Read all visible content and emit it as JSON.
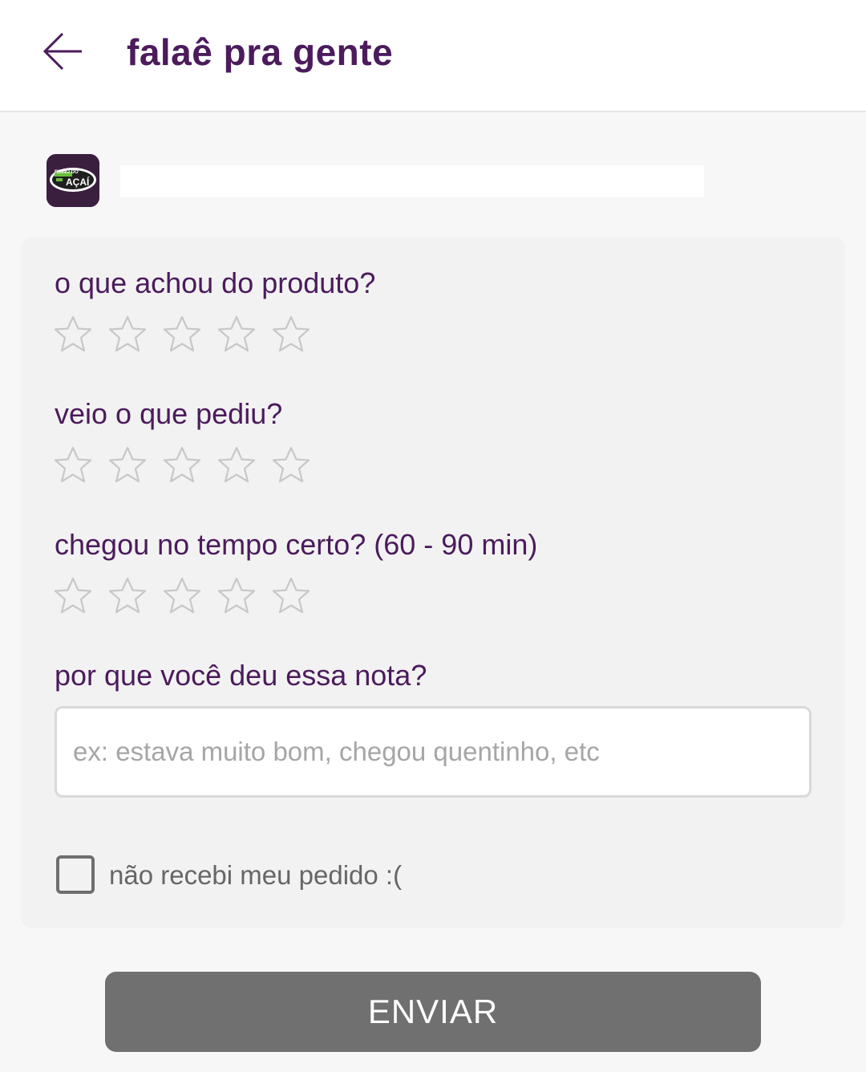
{
  "header": {
    "title": "falaê pra gente",
    "back_icon": "arrow-left-icon"
  },
  "store": {
    "logo_text_top": "REINO DO",
    "logo_text_main": "AÇAÍ",
    "logo_icon": "store-logo"
  },
  "questions": [
    {
      "label": "o que achou do produto?",
      "rating": 0,
      "max": 5
    },
    {
      "label": "veio o que pediu?",
      "rating": 0,
      "max": 5
    },
    {
      "label": "chegou no tempo certo? (60 - 90 min)",
      "rating": 0,
      "max": 5
    }
  ],
  "comment": {
    "label": "por que você deu essa nota?",
    "value": "",
    "placeholder": "ex: estava muito bom, chegou quentinho, etc"
  },
  "not_received": {
    "label": "não recebi meu pedido :(",
    "checked": false
  },
  "submit": {
    "label": "ENVIAR"
  },
  "colors": {
    "accent": "#4b1b5c",
    "star_outline": "#c8c8c8",
    "button_disabled": "#707070",
    "card_background": "#f2f2f2"
  }
}
